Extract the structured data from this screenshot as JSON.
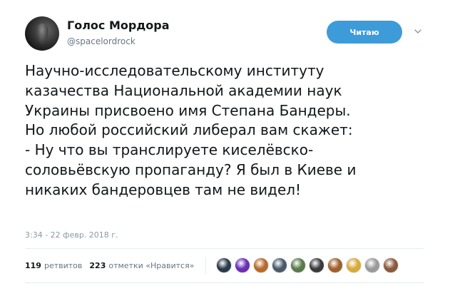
{
  "author": {
    "display_name": "Голос Мордора",
    "handle": "@spacelordrock"
  },
  "follow_button_label": "Читаю",
  "tweet": {
    "text": "Научно-исследовательскому институту\nказачества Национальной академии наук\nУкраины присвоено имя Степана Бандеры.\nНо любой российский либерал вам скажет:\n- Ну что вы транслируете киселёвско-\nсоловьёвскую пропаганду? Я был в Киеве и\nникаких бандеровцев там не видел!",
    "timestamp": "3:34 - 22 февр. 2018 г."
  },
  "stats": {
    "retweets_count": "119",
    "retweets_label": "ретвитов",
    "likes_count": "223",
    "likes_label": "отметки «Нравится»"
  },
  "likers": [
    {
      "name": "liker-avatar-1",
      "color": "#2b3a4a"
    },
    {
      "name": "liker-avatar-2",
      "color": "#6a2fb5"
    },
    {
      "name": "liker-avatar-3",
      "color": "#b86a2a"
    },
    {
      "name": "liker-avatar-4",
      "color": "#4a5a6a"
    },
    {
      "name": "liker-avatar-5",
      "color": "#5a7a4a"
    },
    {
      "name": "liker-avatar-6",
      "color": "#3a3a3a"
    },
    {
      "name": "liker-avatar-7",
      "color": "#a0602a"
    },
    {
      "name": "liker-avatar-8",
      "color": "#d9a93a"
    },
    {
      "name": "liker-avatar-9",
      "color": "#9a9a9a"
    },
    {
      "name": "liker-avatar-10",
      "color": "#8a5a3a"
    }
  ],
  "colors": {
    "accent": "#3d9bd9",
    "text": "#14171a",
    "muted": "#657786"
  }
}
